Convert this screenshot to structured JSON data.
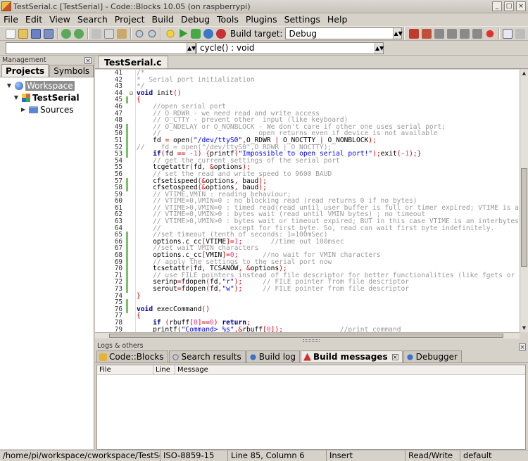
{
  "window": {
    "title": "TestSerial.c [TestSerial] - Code::Blocks 10.05 (on raspberrypi)",
    "btn_min": "_",
    "btn_max": "□",
    "btn_close": "×"
  },
  "menu": [
    "File",
    "Edit",
    "View",
    "Search",
    "Project",
    "Build",
    "Debug",
    "Tools",
    "Plugins",
    "Settings",
    "Help"
  ],
  "toolbar": {
    "build_target_label": "Build target:",
    "build_target_value": "Debug",
    "function_value": "cycle() : void"
  },
  "management": {
    "title": "Management",
    "tabs": [
      "Projects",
      "Symbols"
    ],
    "tree": {
      "workspace": "Workspace",
      "project": "TestSerial",
      "folder": "Sources"
    }
  },
  "editor": {
    "tab": "TestSerial.c",
    "line_numbers": [
      "41",
      "42",
      "43",
      "44",
      "45",
      "46",
      "47",
      "48",
      "49",
      "50",
      "51",
      "52",
      "53",
      "54",
      "55",
      "56",
      "57",
      "58",
      "59",
      "60",
      "61",
      "62",
      "63",
      "64",
      "65",
      "66",
      "67",
      "68",
      "69",
      "70",
      "71",
      "72",
      "73",
      "74",
      "75",
      "76",
      "77",
      "78",
      "79"
    ]
  },
  "logs": {
    "title": "Logs & others",
    "tabs": [
      "Code::Blocks",
      "Search results",
      "Build log",
      "Build messages",
      "Debugger"
    ],
    "columns": [
      "File",
      "Line",
      "Message"
    ]
  },
  "status": {
    "path": "/home/pi/workspace/cworkspace/TestSerial/",
    "encoding": "ISO-8859-15",
    "position": "Line 85, Column 6",
    "mode": "Insert",
    "access": "Read/Write",
    "lang": "default"
  },
  "colors": {
    "comment": "#9a9a9a",
    "keyword": "#00008b",
    "string": "#0000ff",
    "number": "#f0308e",
    "changebar": "#7ac26a"
  }
}
